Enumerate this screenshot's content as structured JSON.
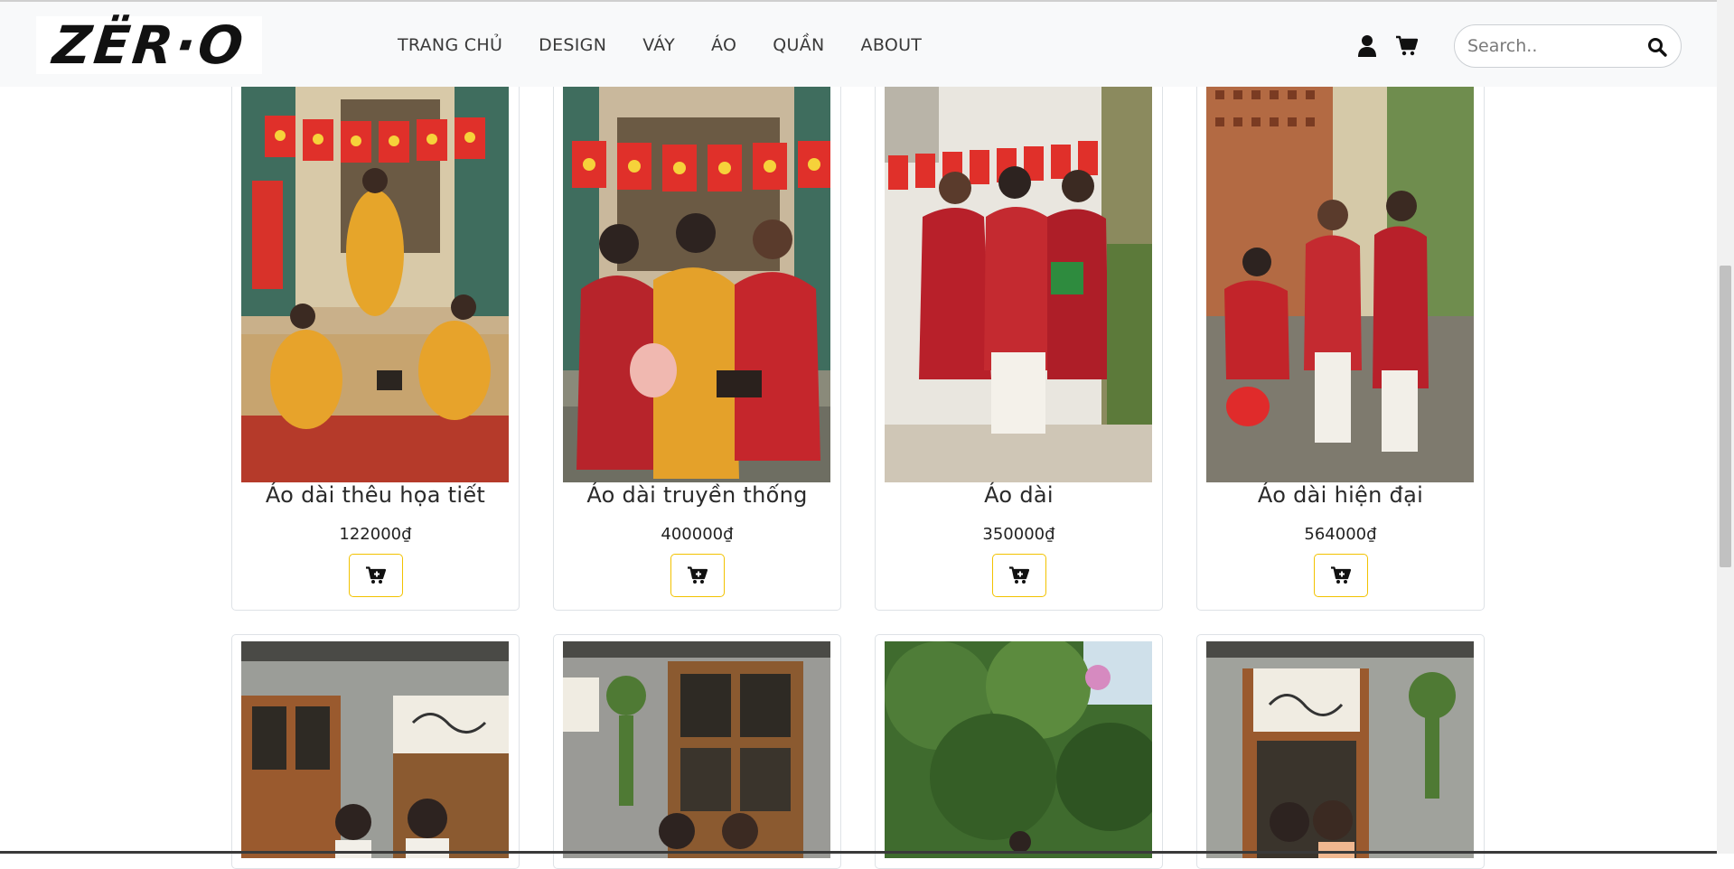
{
  "brand": {
    "logo_text": "ZËR·O"
  },
  "nav": {
    "links": [
      "TRANG CHỦ",
      "DESIGN",
      "VÁY",
      "ÁO",
      "QUẦN",
      "ABOUT"
    ]
  },
  "search": {
    "placeholder": "Search.."
  },
  "icons": {
    "user": "user-icon",
    "cart": "shopping-cart-icon",
    "search": "search-icon",
    "add_to_cart": "cart-plus-icon"
  },
  "colors": {
    "navbar_bg": "#f8f9fa",
    "button_border": "#f2c200"
  },
  "products": [
    {
      "name": "Áo dài thêu họa tiết",
      "price": "122000₫"
    },
    {
      "name": "Áo dài truyền thống",
      "price": "400000₫"
    },
    {
      "name": "Áo dài",
      "price": "350000₫"
    },
    {
      "name": "Áo dài hiện đại",
      "price": "564000₫"
    },
    {
      "name": "",
      "price": ""
    },
    {
      "name": "",
      "price": ""
    },
    {
      "name": "",
      "price": ""
    },
    {
      "name": "",
      "price": ""
    }
  ]
}
